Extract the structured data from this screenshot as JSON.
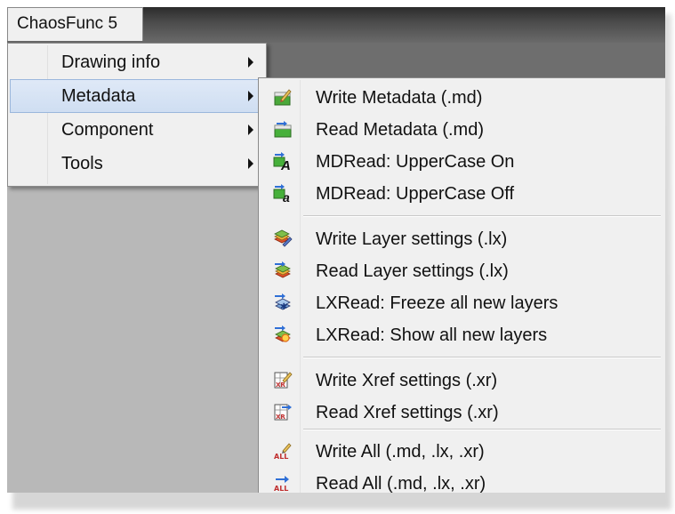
{
  "app": {
    "menu_title": "ChaosFunc 5"
  },
  "dropdown": {
    "items": [
      {
        "label": "Drawing info",
        "has_submenu": true
      },
      {
        "label": "Metadata",
        "has_submenu": true,
        "active": true
      },
      {
        "label": "Component",
        "has_submenu": true
      },
      {
        "label": "Tools",
        "has_submenu": true
      }
    ]
  },
  "submenu": {
    "items": [
      {
        "label": "Write Metadata (.md)",
        "icon": "write-metadata-icon"
      },
      {
        "label": "Read Metadata (.md)",
        "icon": "read-metadata-icon"
      },
      {
        "label": "MDRead: UpperCase On",
        "icon": "uppercase-on-icon"
      },
      {
        "label": "MDRead: UpperCase Off",
        "icon": "uppercase-off-icon"
      },
      {
        "label": "Write Layer settings (.lx)",
        "icon": "write-layers-icon"
      },
      {
        "label": "Read Layer settings (.lx)",
        "icon": "read-layers-icon"
      },
      {
        "label": "LXRead: Freeze all new layers",
        "icon": "freeze-layers-icon"
      },
      {
        "label": "LXRead: Show all new layers",
        "icon": "show-layers-icon"
      },
      {
        "label": "Write Xref settings (.xr)",
        "icon": "write-xref-icon"
      },
      {
        "label": "Read Xref settings (.xr)",
        "icon": "read-xref-icon"
      },
      {
        "label": "Write All (.md, .lx, .xr)",
        "icon": "write-all-icon"
      },
      {
        "label": "Read All (.md, .lx, .xr)",
        "icon": "read-all-icon"
      }
    ]
  },
  "colors": {
    "menu_background": "#f0f0f0",
    "highlight": "#cfdef2",
    "highlight_border": "#9bb7dc",
    "menubar": "#4a4a4a"
  }
}
